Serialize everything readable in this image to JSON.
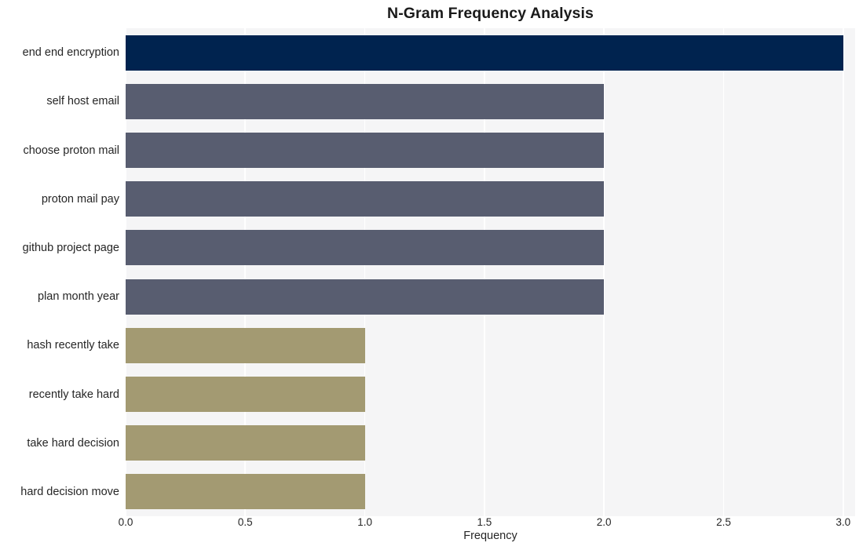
{
  "chart_data": {
    "type": "bar",
    "orientation": "horizontal",
    "title": "N-Gram Frequency Analysis",
    "xlabel": "Frequency",
    "ylabel": "",
    "categories": [
      "end end encryption",
      "self host email",
      "choose proton mail",
      "proton mail pay",
      "github project page",
      "plan month year",
      "hash recently take",
      "recently take hard",
      "take hard decision",
      "hard decision move"
    ],
    "values": [
      3,
      2,
      2,
      2,
      2,
      2,
      1,
      1,
      1,
      1
    ],
    "bar_colors": [
      "#00234f",
      "#585d70",
      "#585d70",
      "#585d70",
      "#585d70",
      "#585d70",
      "#a39a72",
      "#a39a72",
      "#a39a72",
      "#a39a72"
    ],
    "xlim": [
      0,
      3.05
    ],
    "xticks": [
      0.0,
      0.5,
      1.0,
      1.5,
      2.0,
      2.5,
      3.0
    ],
    "xtick_labels": [
      "0.0",
      "0.5",
      "1.0",
      "1.5",
      "2.0",
      "2.5",
      "3.0"
    ],
    "grid": true,
    "grid_axis": "x",
    "grid_color": "#ffffff",
    "plot_background": "#f5f5f6",
    "figure_background": "#ffffff",
    "legend": null
  },
  "style": {
    "title_color": "#1a1a1a",
    "tick_label_color": "#262626"
  }
}
